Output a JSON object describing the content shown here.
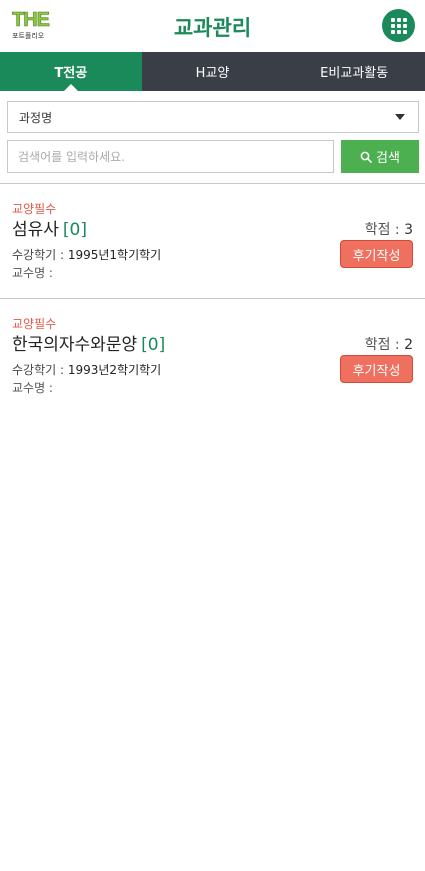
{
  "header": {
    "logo_mark": "THE",
    "logo_sub": "포트폴리오",
    "title": "교과관리",
    "menu_icon": "grid-icon"
  },
  "tabs": [
    {
      "label": "T전공",
      "active": true
    },
    {
      "label": "H교양",
      "active": false
    },
    {
      "label": "E비교과활동",
      "active": false
    }
  ],
  "filter": {
    "select_value": "과정명",
    "search_placeholder": "검색어를 입력하세요.",
    "search_value": "",
    "search_button": "검색"
  },
  "courses": [
    {
      "category": "교양필수",
      "name": "섬유사",
      "count": "[0]",
      "credit_label": "학점 : ",
      "credit_value": "3",
      "semester_label": "수강학기 : ",
      "semester_value": "1995년1학기학기",
      "professor_label": "교수명 :",
      "review_button": "후기작성"
    },
    {
      "category": "교양필수",
      "name": "한국의자수와문양",
      "count": "[0]",
      "credit_label": "학점 : ",
      "credit_value": "2",
      "semester_label": "수강학기 : ",
      "semester_value": "1993년2학기학기",
      "professor_label": "교수명 :",
      "review_button": "후기작성"
    }
  ],
  "colors": {
    "brand_green": "#1a8a5a",
    "tab_bar": "#3a3f47",
    "search_button": "#4caf50",
    "category_red": "#e05a4a",
    "review_button": "#f07060"
  }
}
